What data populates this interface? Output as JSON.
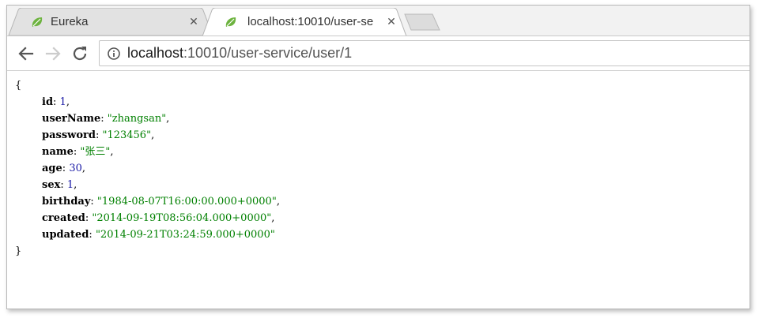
{
  "tabs": [
    {
      "title": "Eureka",
      "active": false,
      "icon": "spring-leaf-icon"
    },
    {
      "title": "localhost:10010/user-se",
      "active": true,
      "icon": "spring-leaf-icon"
    }
  ],
  "toolbar": {
    "url_host": "localhost",
    "url_rest": ":10010/user-service/user/1"
  },
  "json_view": {
    "open_brace": "{",
    "close_brace": "}",
    "fields": [
      {
        "key": "id",
        "value": "1",
        "type": "number",
        "sep": ","
      },
      {
        "key": "userName",
        "value": "\"zhangsan\"",
        "type": "string",
        "sep": ","
      },
      {
        "key": "password",
        "value": "\"123456\"",
        "type": "string",
        "sep": ","
      },
      {
        "key": "name",
        "value": "\"张三\"",
        "type": "string",
        "sep": ","
      },
      {
        "key": "age",
        "value": "30",
        "type": "number",
        "sep": ","
      },
      {
        "key": "sex",
        "value": "1",
        "type": "number",
        "sep": ","
      },
      {
        "key": "birthday",
        "value": "\"1984-08-07T16:00:00.000+0000\"",
        "type": "string",
        "sep": ","
      },
      {
        "key": "created",
        "value": "\"2014-09-19T08:56:04.000+0000\"",
        "type": "string",
        "sep": ","
      },
      {
        "key": "updated",
        "value": "\"2014-09-21T03:24:59.000+0000\"",
        "type": "string",
        "sep": ""
      }
    ]
  },
  "colors": {
    "number": "#1a1aa6",
    "string": "#008000",
    "leaf": "#6db33f"
  }
}
